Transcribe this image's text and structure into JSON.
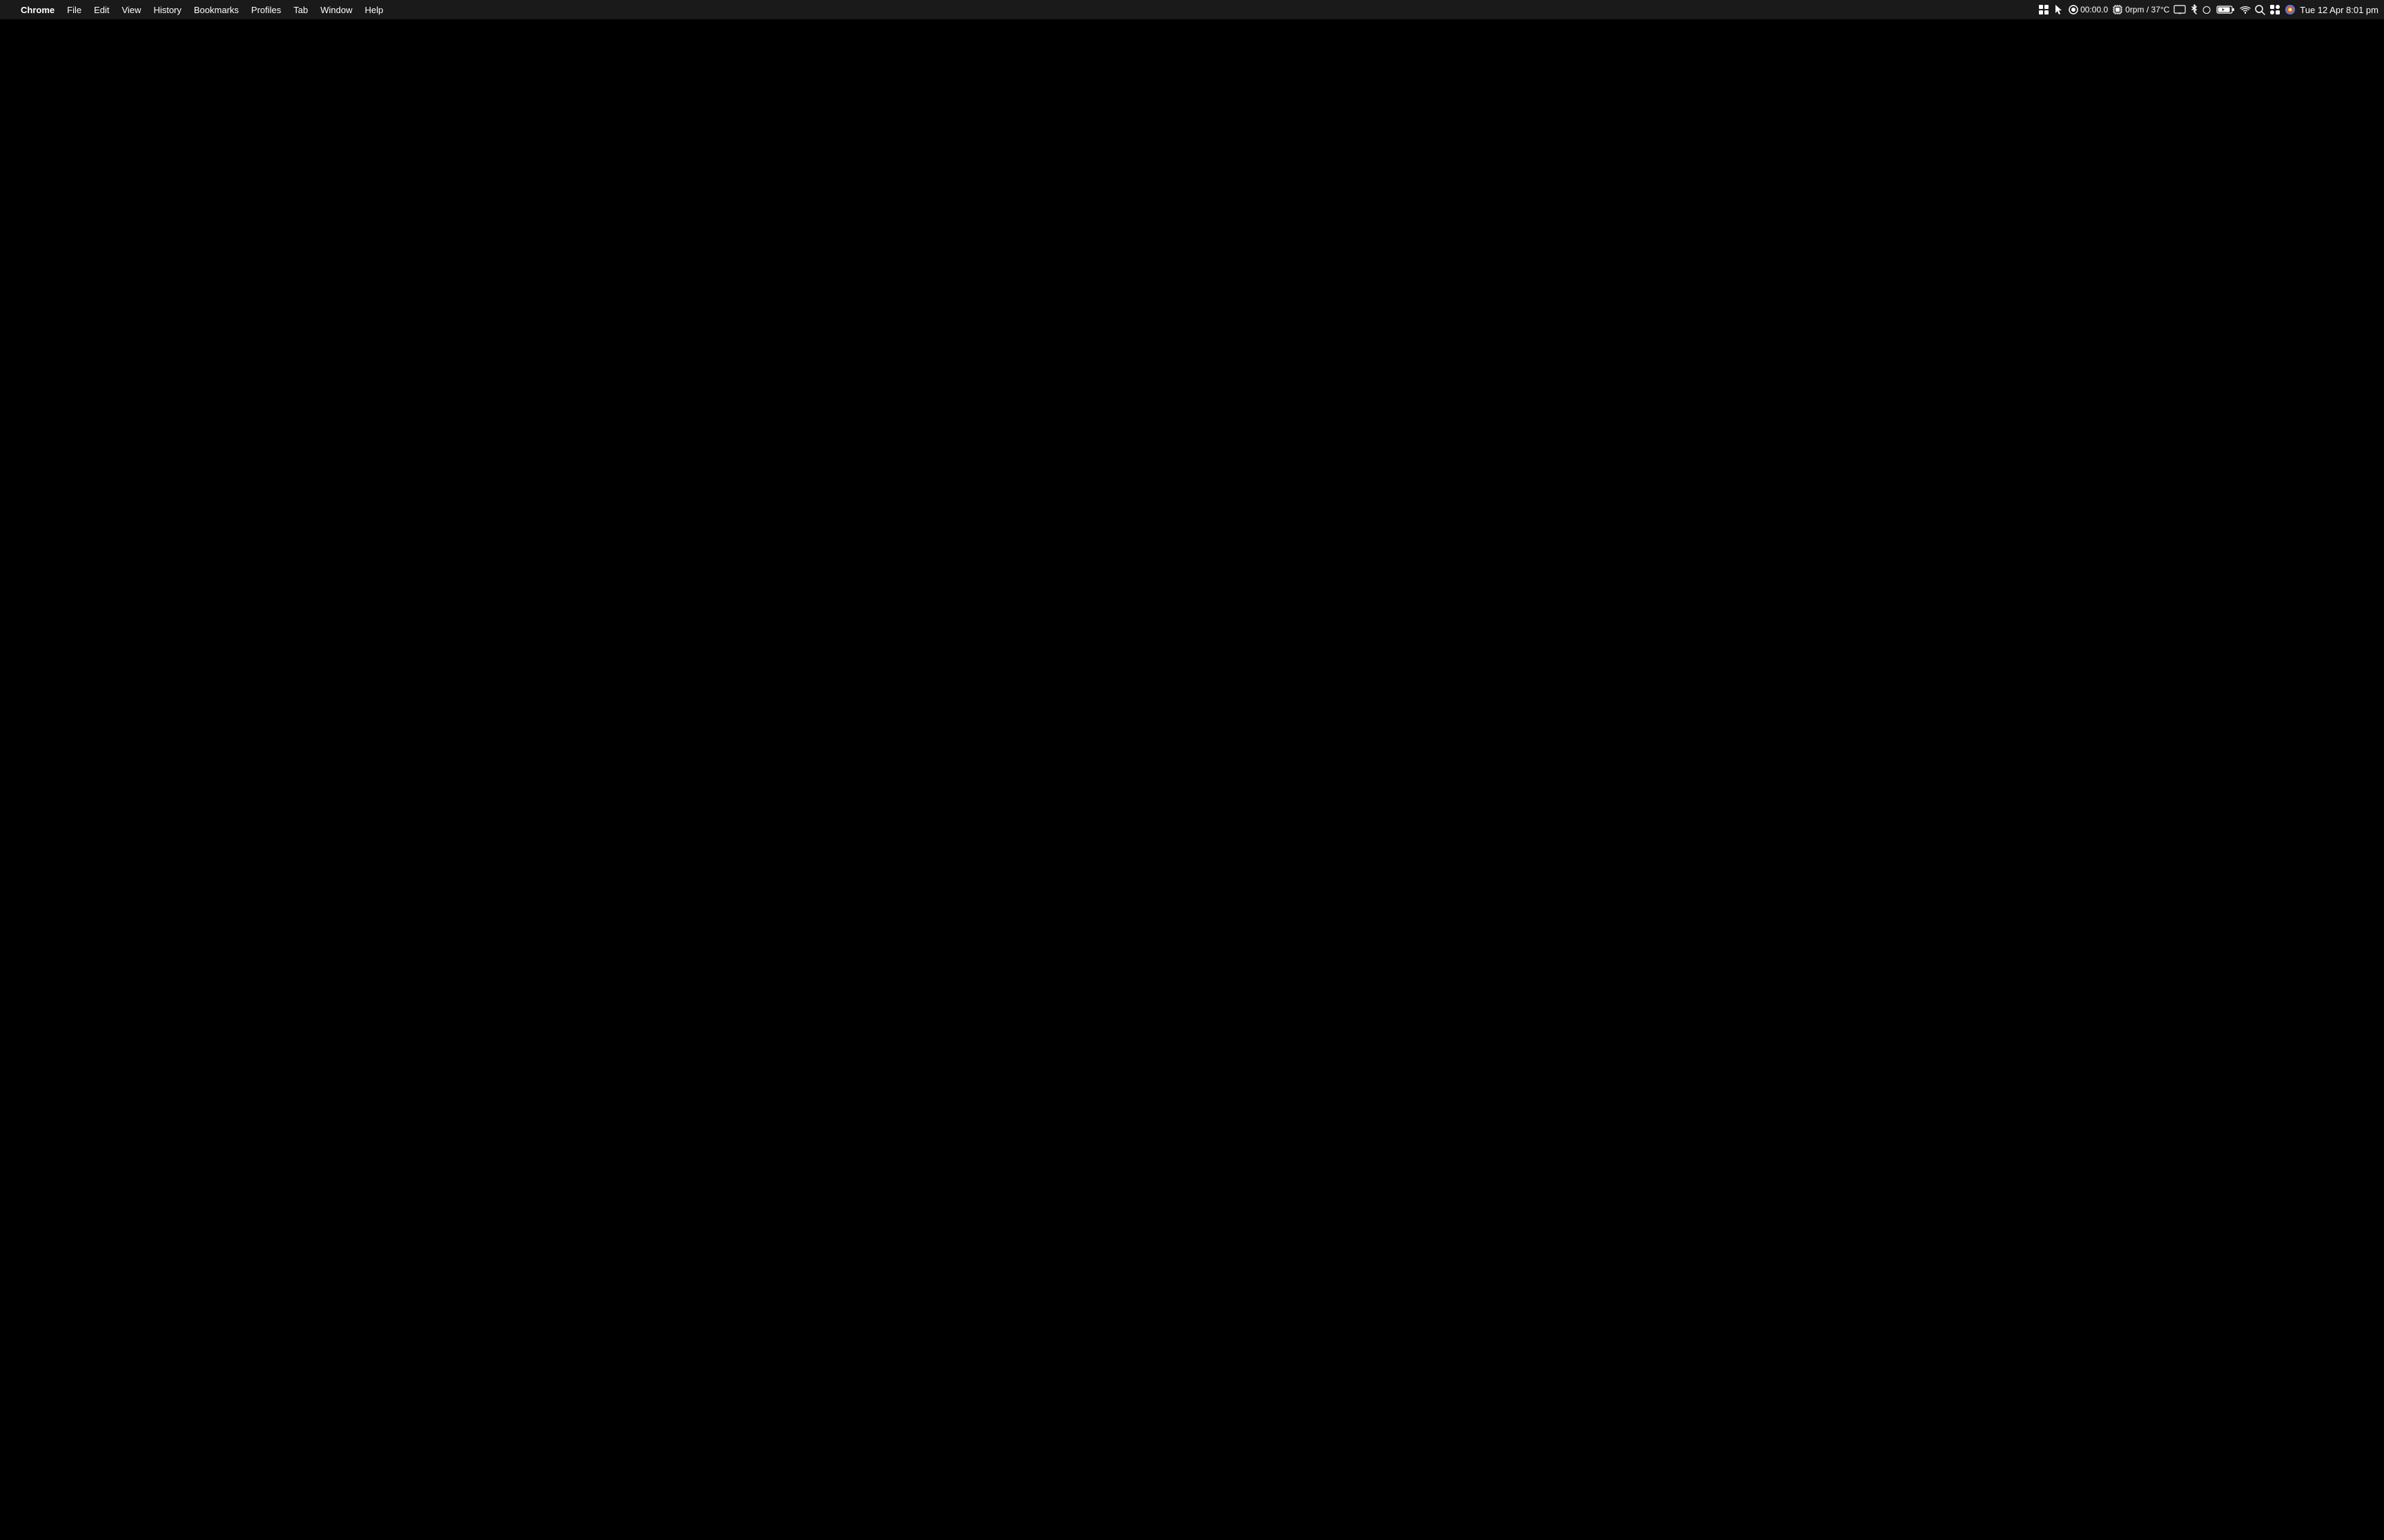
{
  "menubar": {
    "apple_label": "",
    "app_name": "Chrome",
    "menu_items": [
      {
        "label": "File",
        "id": "file"
      },
      {
        "label": "Edit",
        "id": "edit"
      },
      {
        "label": "View",
        "id": "view"
      },
      {
        "label": "History",
        "id": "history"
      },
      {
        "label": "Bookmarks",
        "id": "bookmarks"
      },
      {
        "label": "Profiles",
        "id": "profiles"
      },
      {
        "label": "Tab",
        "id": "tab"
      },
      {
        "label": "Window",
        "id": "window"
      },
      {
        "label": "Help",
        "id": "help"
      }
    ]
  },
  "statusbar": {
    "mission_control": "⊞",
    "timer": "00:00.0",
    "cpu_temp": "0rpm / 37°C",
    "display": "□",
    "bluetooth": "bluetooth",
    "dark_mode": "moon",
    "battery": "charging",
    "wifi": "wifi",
    "search": "search",
    "control_center": "switches",
    "profile_icon": "●",
    "datetime": "Tue 12 Apr  8:01 pm"
  },
  "desktop": {
    "background_color": "#000000"
  }
}
